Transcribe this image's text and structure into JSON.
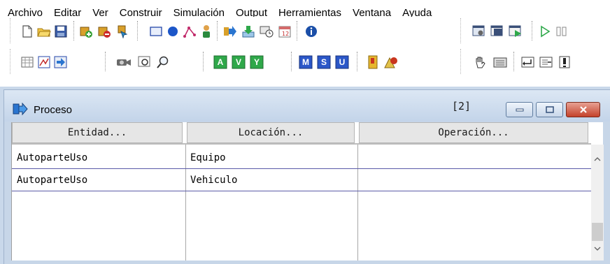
{
  "menubar": {
    "items": [
      "Archivo",
      "Editar",
      "Ver",
      "Construir",
      "Simulación",
      "Output",
      "Herramientas",
      "Ventana",
      "Ayuda"
    ]
  },
  "toolbar_top": {
    "icons": [
      "new-document-icon",
      "open-folder-icon",
      "save-icon",
      "add-entity-icon",
      "remove-entity-icon",
      "entity-pointer-icon",
      "rectangle-icon",
      "circle-icon",
      "path-icon",
      "resource-icon",
      "arrival-icon",
      "download-icon",
      "shift-icon",
      "calendar-icon",
      "info-icon",
      "settings-window-icon",
      "window-icon",
      "run-window-icon",
      "play-icon",
      "pause-icon"
    ]
  },
  "toolbar_bottom": {
    "icons": [
      "grid-icon",
      "chart-icon",
      "routing-icon",
      "camera-icon",
      "zoom-region-icon",
      "zoom-icon"
    ],
    "letter_buttons": [
      "A",
      "V",
      "Y",
      "M",
      "S",
      "U"
    ],
    "extra_icons": [
      "book-icon",
      "shapes-icon",
      "hand-icon",
      "keyboard-icon",
      "return-icon",
      "import-icon",
      "export-icon"
    ]
  },
  "window": {
    "title": "Proceso",
    "count": "[2]"
  },
  "table": {
    "headers": [
      "Entidad...",
      "Locación...",
      "Operación..."
    ],
    "rows": [
      [
        "AutoparteUso",
        "Equipo",
        ""
      ],
      [
        "AutoparteUso",
        "Vehiculo",
        ""
      ]
    ]
  },
  "colors": {
    "window_frame": "#c7d6e8",
    "close_button": "#c4422b",
    "row_divider": "#5a5aa8"
  }
}
